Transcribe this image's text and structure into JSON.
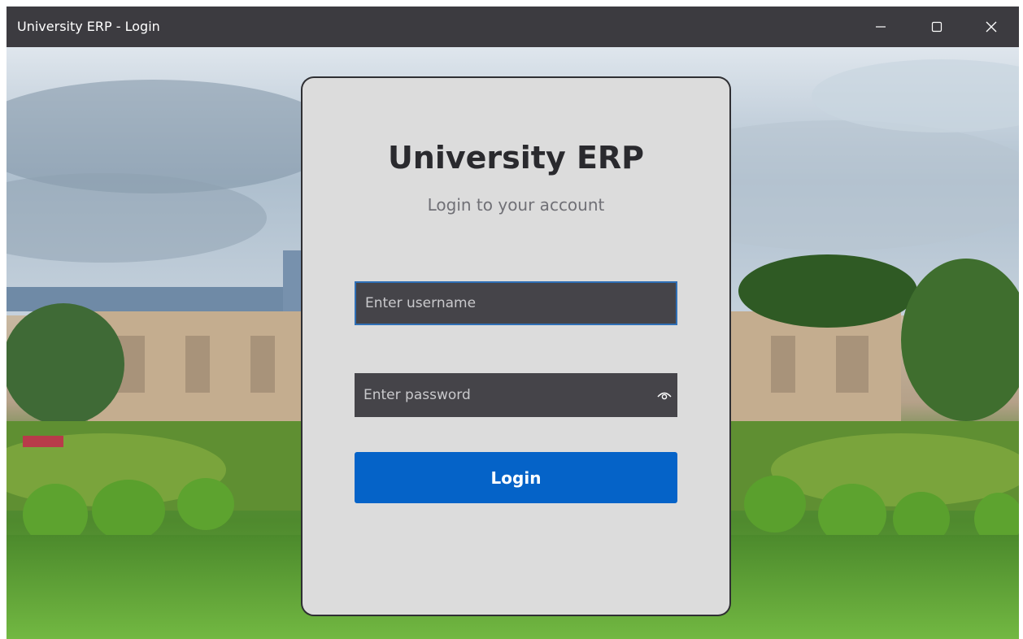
{
  "window": {
    "title": "University ERP - Login"
  },
  "login": {
    "title": "University ERP",
    "subtitle": "Login to your account",
    "username_placeholder": "Enter username",
    "password_placeholder": "Enter password",
    "button_label": "Login"
  },
  "icons": {
    "minimize": "minimize-icon",
    "maximize": "maximize-icon",
    "close": "close-icon",
    "password_toggle": "eye-icon"
  },
  "colors": {
    "titlebar": "#3c3b40",
    "card": "#dcdcdc",
    "input": "#454449",
    "focus_border": "#2f6fb5",
    "accent": "#0563c8"
  }
}
